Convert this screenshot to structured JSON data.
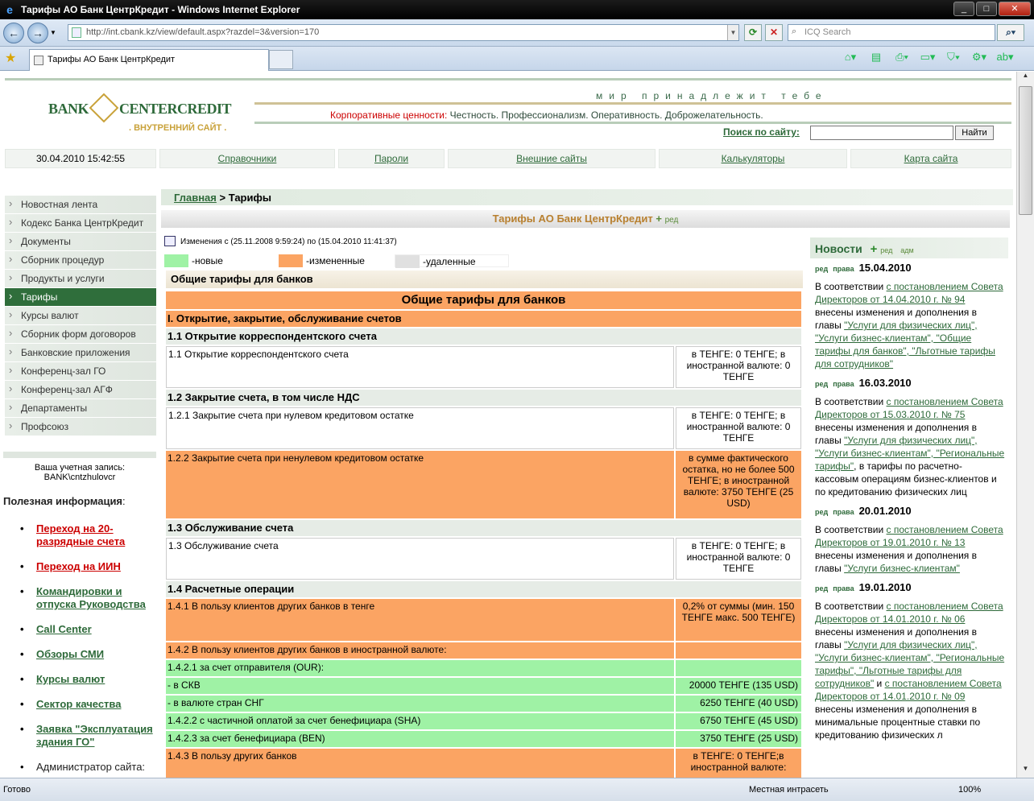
{
  "window": {
    "title": "Тарифы АО Банк ЦентрКредит - Windows Internet Explorer"
  },
  "browser": {
    "url": "http://int.cbank.kz/view/default.aspx?razdel=3&version=170",
    "search_placeholder": "ICQ Search",
    "tab_title": "Тарифы АО Банк ЦентрКредит"
  },
  "statusbar": {
    "ready": "Готово",
    "zone": "Местная интрасеть",
    "zoom": "100%"
  },
  "header": {
    "logo_left": "BANK",
    "logo_right": "CENTERCREDIT",
    "logo_sub": ". ВНУТРЕННИЙ САЙТ .",
    "motto": "мир принадлежит тебе",
    "values_label": "Корпоративные ценности:",
    "values_text": "Честность.  Профессионализм.  Оперативность.  Доброжелательность.",
    "search_label": "Поиск по сайту:",
    "search_button": "Найти"
  },
  "topnav": {
    "datetime": "30.04.2010 15:42:55",
    "links": [
      "Справочники",
      "Пароли",
      "Внешние сайты",
      "Калькуляторы",
      "Карта сайта"
    ]
  },
  "breadcrumb": {
    "home": "Главная",
    "sep": " > ",
    "current": "Тарифы"
  },
  "page_title": "Тарифы АО Банк ЦентрКредит",
  "edit_label": "ред",
  "sidebar": {
    "items": [
      "Новостная лента",
      "Кодекс Банка ЦентрКредит",
      "Документы",
      "Сборник процедур",
      "Продукты и услуги",
      "Тарифы",
      "Курсы валют",
      "Сборник форм договоров",
      "Банковские приложения",
      "Конференц-зал ГО",
      "Конференц-зал АГФ",
      "Департаменты",
      "Профсоюз"
    ],
    "account_label": "Ваша учетная запись:",
    "account": "BANK\\cntzhulovcr"
  },
  "useful": {
    "title": "Полезная информация",
    "title_colon": ":",
    "links": [
      "Переход на 20-разрядные счета",
      "Переход на ИИН",
      "Командировки и отпуска Руководства",
      "Call Center",
      "Обзоры СМИ",
      "Курсы валют",
      "Сектор качества",
      "Заявка  \"Эксплуатация здания ГО\"",
      "Администратор сайта:"
    ]
  },
  "changes": {
    "text": "Изменения с (25.11.2008 9:59:24) по (15.04.2010 11:41:37)",
    "legend_new": "-новые",
    "legend_changed": "-измененные",
    "legend_deleted": "-удаленные",
    "color_new": "#9ff2a5",
    "color_changed": "#fba463",
    "color_deleted": "#e0e0e0"
  },
  "section_header": "Общие тарифы для банков",
  "tariffs": {
    "title": "Общие тарифы для банков",
    "s1": "I. Открытие, закрытие, обслуживание счетов",
    "s11": "1.1 Открытие корреспондентского счета",
    "r11_desc": "1.1 Открытие корреспондентского счета",
    "r11_val": "в ТЕНГЕ: 0 ТЕНГЕ; в иностранной валюте: 0 ТЕНГЕ",
    "s12": "1.2 Закрытие счета, в том числе НДС",
    "r121_desc": "1.2.1 Закрытие счета при нулевом кредитовом остатке",
    "r121_val": "в ТЕНГЕ: 0 ТЕНГЕ; в иностранной валюте: 0 ТЕНГЕ",
    "r122_desc": "1.2.2 Закрытие счета при ненулевом кредитовом остатке",
    "r122_val": "в сумме фактического остатка, но не более 500 ТЕНГЕ; в иностранной валюте: 3750 ТЕНГЕ (25 USD)",
    "s13": "1.3 Обслуживание счета",
    "r13_desc": "1.3 Обслуживание счета",
    "r13_val": "в ТЕНГЕ: 0 ТЕНГЕ; в иностранной валюте: 0 ТЕНГЕ",
    "s14": "1.4 Расчетные операции",
    "r141_desc": "1.4.1 В пользу клиентов других банков в тенге",
    "r141_val": "0,2% от суммы (мин. 150 ТЕНГЕ макс. 500 ТЕНГЕ)",
    "r142_desc": "1.4.2 В пользу клиентов других банков в иностранной валюте:",
    "r1421_desc": "1.4.2.1 за счет отправителя (OUR):",
    "r_skv_desc": " - в СКВ",
    "r_skv_val": "20000 ТЕНГЕ (135 USD)",
    "r_sng_desc": " - в валюте стран СНГ",
    "r_sng_val": "6250 ТЕНГЕ (40 USD)",
    "r1422_desc": "1.4.2.2 с частичной оплатой за счет бенефициара (SHA)",
    "r1422_val": "6750 ТЕНГЕ (45 USD)",
    "r1423_desc": "1.4.2.3 за счет бенефициара (BEN)",
    "r1423_val": "3750 ТЕНГЕ (25 USD)",
    "r143_desc": "1.4.3 В пользу других банков",
    "r143_val": "в ТЕНГЕ: 0 ТЕНГЕ;в иностранной валюте:"
  },
  "news": {
    "title": "Новости",
    "edit": "ред",
    "admin": "адм",
    "tag1": "ред",
    "tag2": "права",
    "items": [
      {
        "date": "15.04.2010",
        "p1": "В соответствии ",
        "l1": "с постановлением Совета Директоров от 14.04.2010 г. № 94",
        "p2": " внесены изменения и дополнения в главы  ",
        "l2": "\"Услуги для физических лиц\", \"Услуги бизнес-клиентам\", \"Общие тарифы для банков\", \"Льготные тарифы для сотрудников\"",
        "p3": ""
      },
      {
        "date": "16.03.2010",
        "p1": "В соответствии ",
        "l1": "с постановлением Совета Директоров от 15.03.2010 г. № 75",
        "p2": " внесены изменения и дополнения в главы  ",
        "l2": "\"Услуги для физических лиц\", \"Услуги бизнес-клиентам\", \"Региональные тарифы\"",
        "p3": ", в тарифы по расчетно-кассовым операциям бизнес-клиентов и по кредитованию физических лиц"
      },
      {
        "date": "20.01.2010",
        "p1": "В соответствии ",
        "l1": "с постановлением Совета Директоров от 19.01.2010 г. № 13",
        "p2": " внесены изменения и дополнения в главы  ",
        "l2": "\"Услуги бизнес-клиентам\"",
        "p3": ""
      },
      {
        "date": "19.01.2010",
        "p1": "В соответствии ",
        "l1": "с постановлением Совета Директоров от 14.01.2010 г. № 06",
        "p2": " внесены изменения и дополнения в главы  ",
        "l2": "\"Услуги для физических лиц\", \"Услуги бизнес-клиентам\", \"Региональные тарифы\", \"Льготные тарифы для сотрудников\"",
        "p3": " и ",
        "l3": "с постановлением Совета Директоров от 14.01.2010 г. № 09",
        "p4": " внесены изменения и дополнения в минимальные процентные ставки по кредитованию физических л"
      }
    ]
  }
}
